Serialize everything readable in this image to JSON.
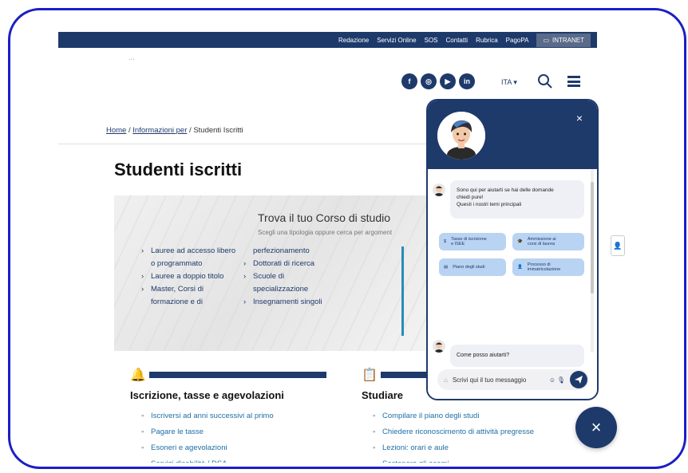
{
  "topbar": {
    "links": [
      "Redazione",
      "Servizi Online",
      "SOS",
      "Contatti",
      "Rubrica",
      "PagoPA"
    ],
    "intranet": "INTRANET"
  },
  "header": {
    "logo_text": "·‧‧",
    "socials": [
      "f",
      "◎",
      "▶",
      "in"
    ],
    "language": "ITA ▾"
  },
  "breadcrumb": {
    "home": "Home",
    "sep1": "/",
    "info": "Informazioni per",
    "sep2": "/",
    "current": "Studenti Iscritti"
  },
  "page": {
    "title": "Studenti iscritti"
  },
  "hero": {
    "title": "Trova il tuo Corso di studio",
    "subtitle": "Scegli una tipologia oppure cerca per argoment",
    "col1": [
      {
        "lines": [
          "Lauree ad accesso libero",
          "o programmato"
        ]
      },
      {
        "lines": [
          "Lauree a doppio titolo"
        ]
      },
      {
        "lines": [
          "Master, Corsi di",
          "formazione e di"
        ]
      }
    ],
    "col2_top": "perfezionamento",
    "col2": [
      {
        "lines": [
          "Dottorati di ricerca"
        ]
      },
      {
        "lines": [
          "Scuole di",
          "specializzazione"
        ]
      },
      {
        "lines": [
          "Insegnamenti singoli"
        ]
      }
    ]
  },
  "sections": {
    "left": {
      "title": "Iscrizione, tasse e agevolazioni",
      "items": [
        "Iscriversi ad anni successivi al primo",
        "Pagare le tasse",
        "Esoneri e agevolazioni",
        "Servizi disabilità / DSA"
      ]
    },
    "right": {
      "title": "Studiare",
      "items": [
        "Compilare il piano degli studi",
        "Chiedere riconoscimento di attività pregresse",
        "Lezioni: orari e aule",
        "Sostenere gli esami"
      ]
    }
  },
  "chat": {
    "close": "×",
    "greeting_lines": [
      "Sono qui per aiutarti se hai delle domande",
      "chiedi pure!",
      "Questi i nostri temi principali"
    ],
    "chips": [
      {
        "icon": "$",
        "label_lines": [
          "Tasse di iscrizione",
          "e ISEE"
        ]
      },
      {
        "icon": "🎓",
        "label_lines": [
          "Ammissione ai",
          "corsi di laurea"
        ]
      },
      {
        "icon": "▤",
        "label_lines": [
          "Piano degli studi"
        ]
      },
      {
        "icon": "👤",
        "label_lines": [
          "Processo di",
          "immatricolazione"
        ]
      }
    ],
    "question": "Come posso aiutarti?",
    "input_placeholder": "Scrivi qui il tuo messaggio",
    "fab": "×"
  },
  "colors": {
    "brand": "#1e3a6b",
    "link": "#1e6fa6",
    "chip": "#b9d3f2",
    "frame": "#1a1fc4"
  }
}
